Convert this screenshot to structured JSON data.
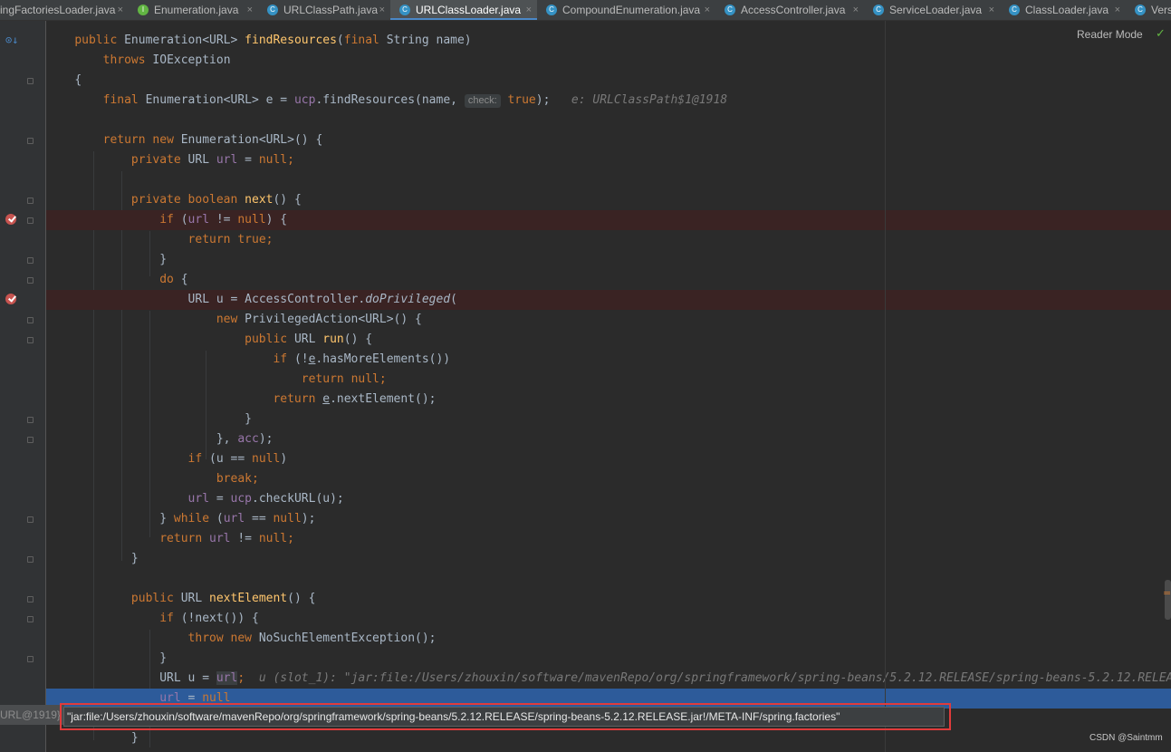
{
  "tabs": [
    {
      "label": "ingFactoriesLoader.java",
      "active": false
    },
    {
      "label": "Enumeration.java",
      "active": false
    },
    {
      "label": "URLClassPath.java",
      "active": false
    },
    {
      "label": "URLClassLoader.java",
      "active": true
    },
    {
      "label": "CompoundEnumeration.java",
      "active": false
    },
    {
      "label": "AccessController.java",
      "active": false
    },
    {
      "label": "ServiceLoader.java",
      "active": false
    },
    {
      "label": "ClassLoader.java",
      "active": false
    },
    {
      "label": "Vers",
      "active": false
    }
  ],
  "tab_close_glyph": "×",
  "toolbar": {
    "reader_mode": "Reader Mode"
  },
  "code": {
    "l1_kw": "public",
    "l1_type": "Enumeration<URL>",
    "l1_fn": "findResources",
    "l1_open": "(",
    "l1_final": "final",
    "l1_rest": "String name)",
    "l2_kw": "throws",
    "l2_rest": "IOException",
    "l3": "{",
    "l4_final": "final",
    "l4_a": "Enumeration<URL> e = ",
    "l4_ucp": "ucp",
    "l4_b": ".findResources(name, ",
    "l4_hint": "check:",
    "l4_true": "true",
    "l4_end": ");",
    "l4_inline": "e: URLClassPath$1@1918",
    "l5_return": "return",
    "l5_new": "new",
    "l5_rest": "Enumeration<URL>() {",
    "l6_private": "private",
    "l6_a": "URL ",
    "l6_url": "url",
    "l6_eq": " = ",
    "l6_null": "null",
    "l6_semi": ";",
    "l7_private": "private",
    "l7_boolean": "boolean",
    "l7_fn": "next",
    "l7_rest": "() {",
    "l8_if": "if",
    "l8_a": "(",
    "l8_url": "url",
    "l8_b": " != ",
    "l8_null": "null",
    "l8_c": ") {",
    "l9_return": "return",
    "l9_true": "true",
    "l9_semi": ";",
    "l10": "}",
    "l11_do": "do",
    "l11_rest": "{",
    "l12_a": "URL u = AccessController.",
    "l12_fn": "doPrivileged",
    "l12_b": "(",
    "l13_new": "new",
    "l13_rest": "PrivilegedAction<URL>() {",
    "l14_public": "public",
    "l14_a": "URL ",
    "l14_fn": "run",
    "l14_b": "() {",
    "l15_if": "if",
    "l15_a": "(!",
    "l15_e": "e",
    "l15_b": ".hasMoreElements())",
    "l16_return": "return",
    "l16_null": "null",
    "l16_semi": ";",
    "l17_return": "return",
    "l17_e": "e",
    "l17_rest": ".nextElement();",
    "l18": "}",
    "l19_a": "}, ",
    "l19_acc": "acc",
    "l19_b": ");",
    "l20_if": "if",
    "l20_a": "(u == ",
    "l20_null": "null",
    "l20_b": ")",
    "l21_break": "break",
    "l21_semi": ";",
    "l22_url": "url",
    "l22_a": " = ",
    "l22_ucp": "ucp",
    "l22_b": ".checkURL(u);",
    "l23_a": "} ",
    "l23_while": "while",
    "l23_b": " (",
    "l23_url": "url",
    "l23_c": " == ",
    "l23_null": "null",
    "l23_d": ");",
    "l24_return": "return",
    "l24_url": "url",
    "l24_a": " != ",
    "l24_null": "null",
    "l24_semi": ";",
    "l25": "}",
    "l26_public": "public",
    "l26_a": "URL ",
    "l26_fn": "nextElement",
    "l26_b": "() {",
    "l27_if": "if",
    "l27_rest": "(!next()) {",
    "l28_throw": "throw",
    "l28_new": "new",
    "l28_rest": "NoSuchElementException();",
    "l29": "}",
    "l30_a": "URL u = ",
    "l30_url": "url",
    "l30_semi": ";",
    "l30_inline": "u (slot_1): \"jar:file:/Users/zhouxin/software/mavenRepo/org/springframework/spring-beans/5.2.12.RELEASE/spring-beans-5.2.12.RELEAS",
    "l31_url": "url",
    "l31_a": " = ",
    "l31_null": "null",
    "l32": "}"
  },
  "tooltip": {
    "prefix": "URL@1919}",
    "value": "\"jar:file:/Users/zhouxin/software/mavenRepo/org/springframework/spring-beans/5.2.12.RELEASE/spring-beans-5.2.12.RELEASE.jar!/META-INF/spring.factories\""
  },
  "watermark": "CSDN @Saintmm",
  "colors": {
    "keyword": "#cc7832",
    "function": "#ffc66d",
    "field": "#9876aa",
    "text": "#a9b7c6",
    "background": "#2b2b2b",
    "execution_line": "#2d5b9a",
    "breakpoint": "#c75450",
    "highlight_box": "#e03b3b"
  },
  "icons": [
    "class-icon",
    "interface-icon",
    "breakpoint-icon",
    "inspection-ok-icon",
    "close-icon"
  ]
}
